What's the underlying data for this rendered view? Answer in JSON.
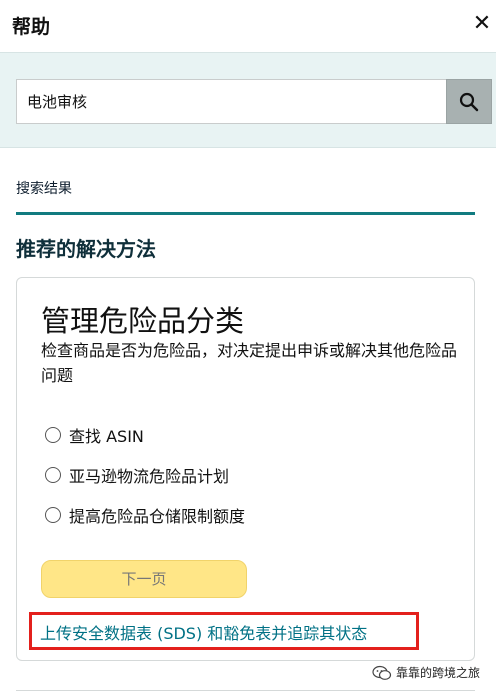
{
  "header": {
    "title": "帮助",
    "close_glyph": "✕"
  },
  "search": {
    "value": "电池审核",
    "icon": "search-icon"
  },
  "results": {
    "tab_label": "搜索结果",
    "section_title": "推荐的解决方法"
  },
  "card": {
    "title": "管理危险品分类",
    "description": "检查商品是否为危险品，对决定提出申诉或解决其他危险品问题",
    "options": [
      {
        "label": "查找 ASIN",
        "selected": false
      },
      {
        "label": "亚马逊物流危险品计划",
        "selected": false
      },
      {
        "label": "提高危险品仓储限制额度",
        "selected": false
      }
    ],
    "next_label": "下一页"
  },
  "link": {
    "label": "上传安全数据表 (SDS) 和豁免表并追踪其状态",
    "highlight_color": "#e3201c"
  },
  "watermark": {
    "text": "靠靠的跨境之旅",
    "icon": "wechat-icon"
  },
  "colors": {
    "accent_teal": "#117b80",
    "link": "#007185",
    "button_yellow": "#ffe687",
    "search_band": "#e8f3f3"
  }
}
